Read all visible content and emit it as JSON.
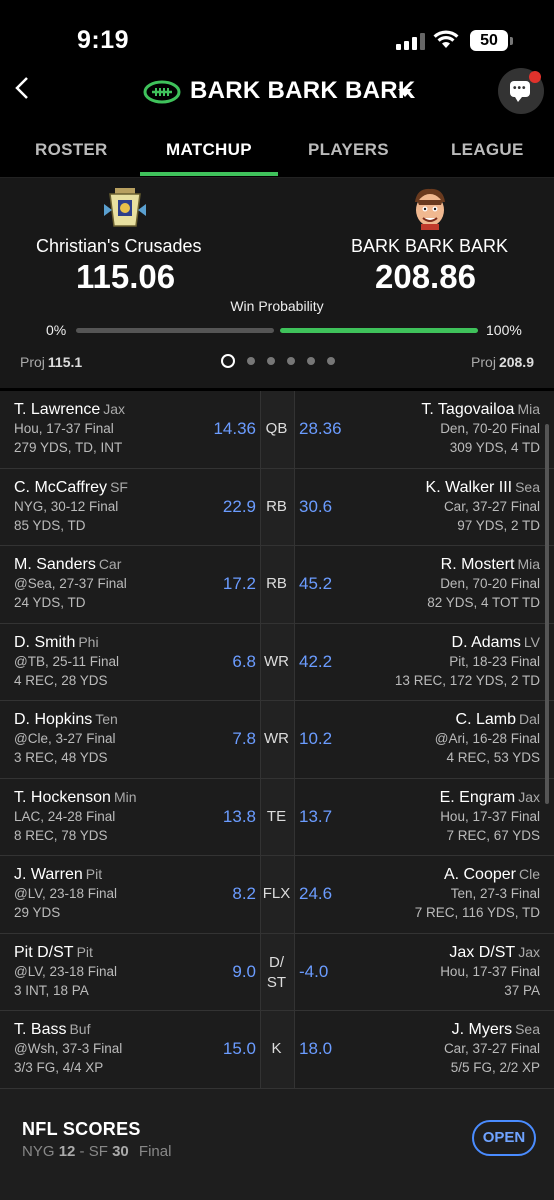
{
  "status_bar": {
    "time": "9:19",
    "battery": "50"
  },
  "header": {
    "title": "BARK BARK BARK",
    "icons": [
      "back-chevron-icon",
      "football-logo-icon",
      "dropdown-caret-icon",
      "chat-icon"
    ]
  },
  "tabs": [
    {
      "label": "ROSTER"
    },
    {
      "label": "MATCHUP"
    },
    {
      "label": "PLAYERS"
    },
    {
      "label": "LEAGUE"
    }
  ],
  "summary": {
    "home": {
      "name": "Christian's Crusades",
      "score": "115.06",
      "proj_label": "Proj",
      "proj": "115.1",
      "win_pct": "0%"
    },
    "away": {
      "name": "BARK BARK BARK",
      "score": "208.86",
      "proj_label": "Proj",
      "proj": "208.9",
      "win_pct": "100%"
    },
    "win_prob_label": "Win Probability",
    "win_prob_home_fraction": 0,
    "win_prob_away_fraction": 1
  },
  "matchup": [
    {
      "pos": "QB",
      "left": {
        "name": "T. Lawrence",
        "team": "Jax",
        "line2": "Hou, 17-37 Final",
        "line3": "279 YDS, TD, INT",
        "pts": "14.36"
      },
      "right": {
        "name": "T. Tagovailoa",
        "team": "Mia",
        "line2": "Den, 70-20 Final",
        "line3": "309 YDS, 4 TD",
        "pts": "28.36"
      }
    },
    {
      "pos": "RB",
      "left": {
        "name": "C. McCaffrey",
        "team": "SF",
        "line2": "NYG, 30-12 Final",
        "line3": "85 YDS, TD",
        "pts": "22.9"
      },
      "right": {
        "name": "K. Walker III",
        "team": "Sea",
        "line2": "Car, 37-27 Final",
        "line3": "97 YDS, 2 TD",
        "pts": "30.6"
      }
    },
    {
      "pos": "RB",
      "left": {
        "name": "M. Sanders",
        "team": "Car",
        "line2": "@Sea, 27-37 Final",
        "line3": "24 YDS, TD",
        "pts": "17.2"
      },
      "right": {
        "name": "R. Mostert",
        "team": "Mia",
        "line2": "Den, 70-20 Final",
        "line3": "82 YDS, 4 TOT TD",
        "pts": "45.2"
      }
    },
    {
      "pos": "WR",
      "left": {
        "name": "D. Smith",
        "team": "Phi",
        "line2": "@TB, 25-11 Final",
        "line3": "4 REC, 28 YDS",
        "pts": "6.8"
      },
      "right": {
        "name": "D. Adams",
        "team": "LV",
        "line2": "Pit, 18-23 Final",
        "line3": "13 REC, 172 YDS, 2 TD",
        "pts": "42.2"
      }
    },
    {
      "pos": "WR",
      "left": {
        "name": "D. Hopkins",
        "team": "Ten",
        "line2": "@Cle, 3-27 Final",
        "line3": "3 REC, 48 YDS",
        "pts": "7.8"
      },
      "right": {
        "name": "C. Lamb",
        "team": "Dal",
        "line2": "@Ari, 16-28 Final",
        "line3": "4 REC, 53 YDS",
        "pts": "10.2"
      }
    },
    {
      "pos": "TE",
      "left": {
        "name": "T. Hockenson",
        "team": "Min",
        "line2": "LAC, 24-28 Final",
        "line3": "8 REC, 78 YDS",
        "pts": "13.8"
      },
      "right": {
        "name": "E. Engram",
        "team": "Jax",
        "line2": "Hou, 17-37 Final",
        "line3": "7 REC, 67 YDS",
        "pts": "13.7"
      }
    },
    {
      "pos": "FLX",
      "left": {
        "name": "J. Warren",
        "team": "Pit",
        "line2": "@LV, 23-18 Final",
        "line3": "29 YDS",
        "pts": "8.2"
      },
      "right": {
        "name": "A. Cooper",
        "team": "Cle",
        "line2": "Ten, 27-3 Final",
        "line3": "7 REC, 116 YDS, TD",
        "pts": "24.6"
      }
    },
    {
      "pos": "D/ST",
      "left": {
        "name": "Pit D/ST",
        "team": "Pit",
        "line2": "@LV, 23-18 Final",
        "line3": "3 INT, 18 PA",
        "pts": "9.0"
      },
      "right": {
        "name": "Jax D/ST",
        "team": "Jax",
        "line2": "Hou, 17-37 Final",
        "line3": "37 PA",
        "pts": "-4.0"
      }
    },
    {
      "pos": "K",
      "left": {
        "name": "T. Bass",
        "team": "Buf",
        "line2": "@Wsh, 37-3 Final",
        "line3": "3/3 FG, 4/4 XP",
        "pts": "15.0"
      },
      "right": {
        "name": "J. Myers",
        "team": "Sea",
        "line2": "Car, 37-27 Final",
        "line3": "5/5 FG, 2/2 XP",
        "pts": "18.0"
      }
    }
  ],
  "bottom_bar": {
    "title": "NFL SCORES",
    "team1": "NYG",
    "score1": "12",
    "sep": "-",
    "team2": "SF",
    "score2": "30",
    "status": "Final",
    "button": "OPEN"
  },
  "colors": {
    "accent": "#3fc25b",
    "points": "#6b9cff",
    "button": "#4a8cff",
    "background": "#000000",
    "panel": "#181818"
  }
}
